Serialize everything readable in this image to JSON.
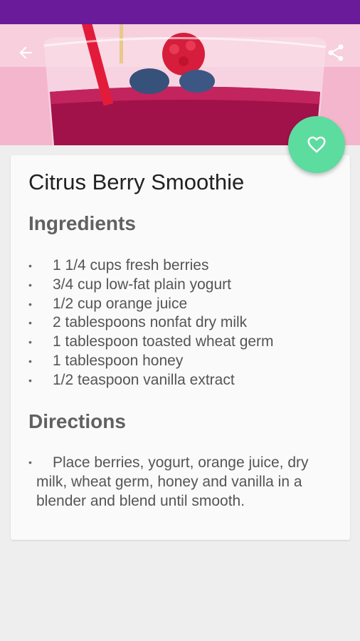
{
  "recipe": {
    "title": "Citrus Berry Smoothie",
    "ingredients_heading": "Ingredients",
    "ingredients": [
      "1 1/4 cups fresh berries",
      "3/4 cup low-fat plain yogurt",
      "1/2 cup orange juice",
      "2 tablespoons nonfat dry milk",
      "1 tablespoon toasted wheat germ",
      "1 tablespoon honey",
      "1/2 teaspoon vanilla extract"
    ],
    "directions_heading": "Directions",
    "directions": [
      "Place berries, yogurt, orange juice, dry milk, wheat germ, honey and vanilla in a blender and blend until smooth."
    ]
  },
  "toolbar": {
    "back_icon": "arrow-left-icon",
    "share_icon": "share-icon"
  },
  "fab": {
    "icon": "heart-outline-icon"
  },
  "colors": {
    "status_bar": "#6a1b9a",
    "fab": "#5ddc9f",
    "background": "#eeeeee",
    "card": "#fafafa"
  }
}
